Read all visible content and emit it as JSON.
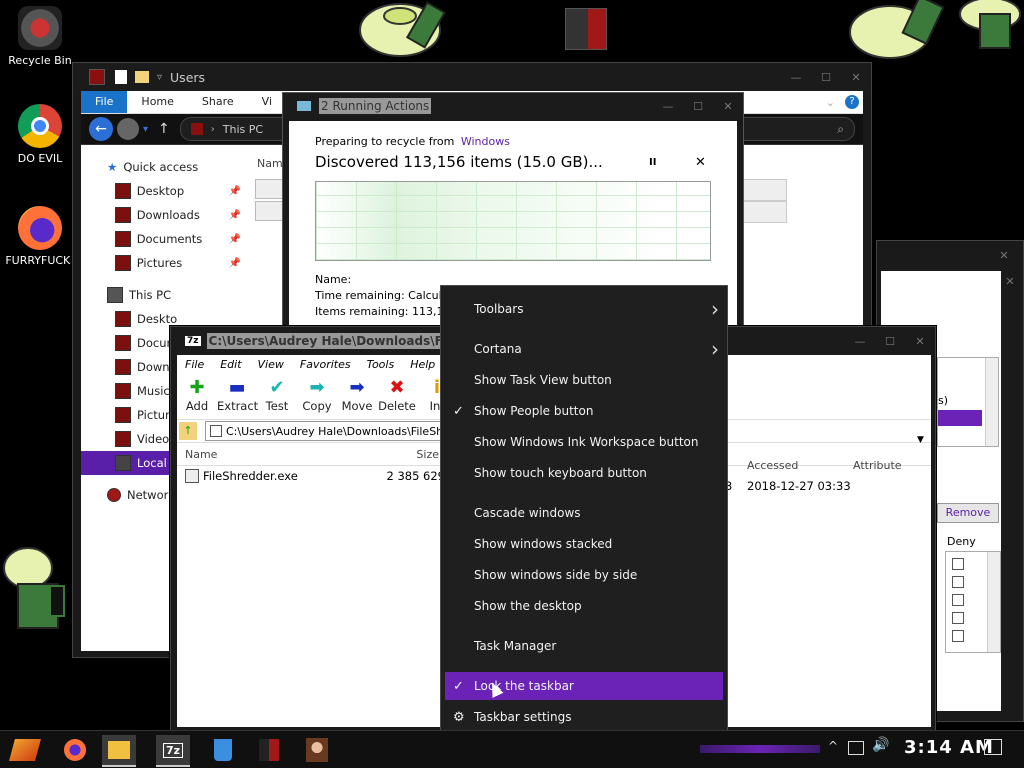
{
  "desktop": {
    "icons": [
      {
        "label": "Recycle Bin"
      },
      {
        "label": "DO EVIL"
      },
      {
        "label": "FURRYFUCK!"
      }
    ]
  },
  "explorer": {
    "title": "Users",
    "ribbon_tabs": [
      "File",
      "Home",
      "Share",
      "Vi"
    ],
    "breadcrumb": "This PC",
    "column_header": "Nam",
    "quick_access": "Quick access",
    "sidebar_items": [
      {
        "label": "Desktop",
        "pinned": true
      },
      {
        "label": "Downloads",
        "pinned": true
      },
      {
        "label": "Documents",
        "pinned": true
      },
      {
        "label": "Pictures",
        "pinned": true
      }
    ],
    "this_pc": "This PC",
    "this_pc_items": [
      "Deskto",
      "Docume",
      "Downlo",
      "Music",
      "Picture",
      "Videos",
      "Local D"
    ],
    "network": "Network"
  },
  "recycle_dialog": {
    "title": "2 Running Actions",
    "preparing": "Preparing to recycle from",
    "source": "Windows",
    "discovered": "Discovered 113,156 items (15.0 GB)...",
    "pause_label": "II",
    "close_label": "✕",
    "name_label": "Name:",
    "time_remaining": "Time remaining:  Calcula",
    "items_remaining": "Items remaining:  113,15"
  },
  "sevenzip": {
    "app_icon": "7z",
    "title": "C:\\Users\\Audrey Hale\\Downloads\\FileSh",
    "menu": [
      "File",
      "Edit",
      "View",
      "Favorites",
      "Tools",
      "Help"
    ],
    "toolbar": [
      {
        "label": "Add",
        "glyph": "✚",
        "color": "#19a319"
      },
      {
        "label": "Extract",
        "glyph": "▬",
        "color": "#1a2fbf"
      },
      {
        "label": "Test",
        "glyph": "✔",
        "color": "#1ab3b3"
      },
      {
        "label": "Copy",
        "glyph": "➡",
        "color": "#1ab3b3"
      },
      {
        "label": "Move",
        "glyph": "➡",
        "color": "#1a2fbf"
      },
      {
        "label": "Delete",
        "glyph": "✖",
        "color": "#d11"
      },
      {
        "label": "Inf",
        "glyph": "i",
        "color": "#d9a000"
      }
    ],
    "address": "C:\\Users\\Audrey Hale\\Downloads\\FileShre",
    "columns": [
      "Name",
      "Size"
    ],
    "files": [
      {
        "name": "FileShredder.exe",
        "size": "2 385 629"
      }
    ],
    "right_columns": [
      "Accessed",
      "Attribute"
    ],
    "right_row": {
      "prefix": "3",
      "accessed": "2018-12-27 03:33"
    }
  },
  "properties": {
    "s_char": "s)",
    "remove_button": "Remove",
    "deny_header": "Deny"
  },
  "context_menu": {
    "items": [
      {
        "label": "Toolbars",
        "submenu": true,
        "checked": false
      },
      {
        "label": "Cortana",
        "submenu": true,
        "checked": false
      },
      {
        "label": "Show Task View button",
        "submenu": false,
        "checked": false
      },
      {
        "label": "Show People button",
        "submenu": false,
        "checked": true
      },
      {
        "label": "Show Windows Ink Workspace button",
        "submenu": false,
        "checked": false
      },
      {
        "label": "Show touch keyboard button",
        "submenu": false,
        "checked": false
      },
      {
        "label": "Cascade windows",
        "submenu": false,
        "checked": false
      },
      {
        "label": "Show windows stacked",
        "submenu": false,
        "checked": false
      },
      {
        "label": "Show windows side by side",
        "submenu": false,
        "checked": false
      },
      {
        "label": "Show the desktop",
        "submenu": false,
        "checked": false
      },
      {
        "label": "Task Manager",
        "submenu": false,
        "checked": false
      },
      {
        "label": "Lock the taskbar",
        "submenu": false,
        "checked": true,
        "highlighted": true
      },
      {
        "label": "Taskbar settings",
        "submenu": false,
        "checked": false,
        "icon": "gear-icon"
      }
    ]
  },
  "taskbar": {
    "clock": "3:14 AM",
    "apps": [
      "start-icon",
      "firefox-icon",
      "file-explorer-icon",
      "7zip-icon",
      "recycle-icon",
      "app-icon",
      "portrait-icon"
    ]
  },
  "colors": {
    "accent": "#6a23b6",
    "menu_bg": "#1f1f1f",
    "file_tab": "#1a73c8"
  }
}
